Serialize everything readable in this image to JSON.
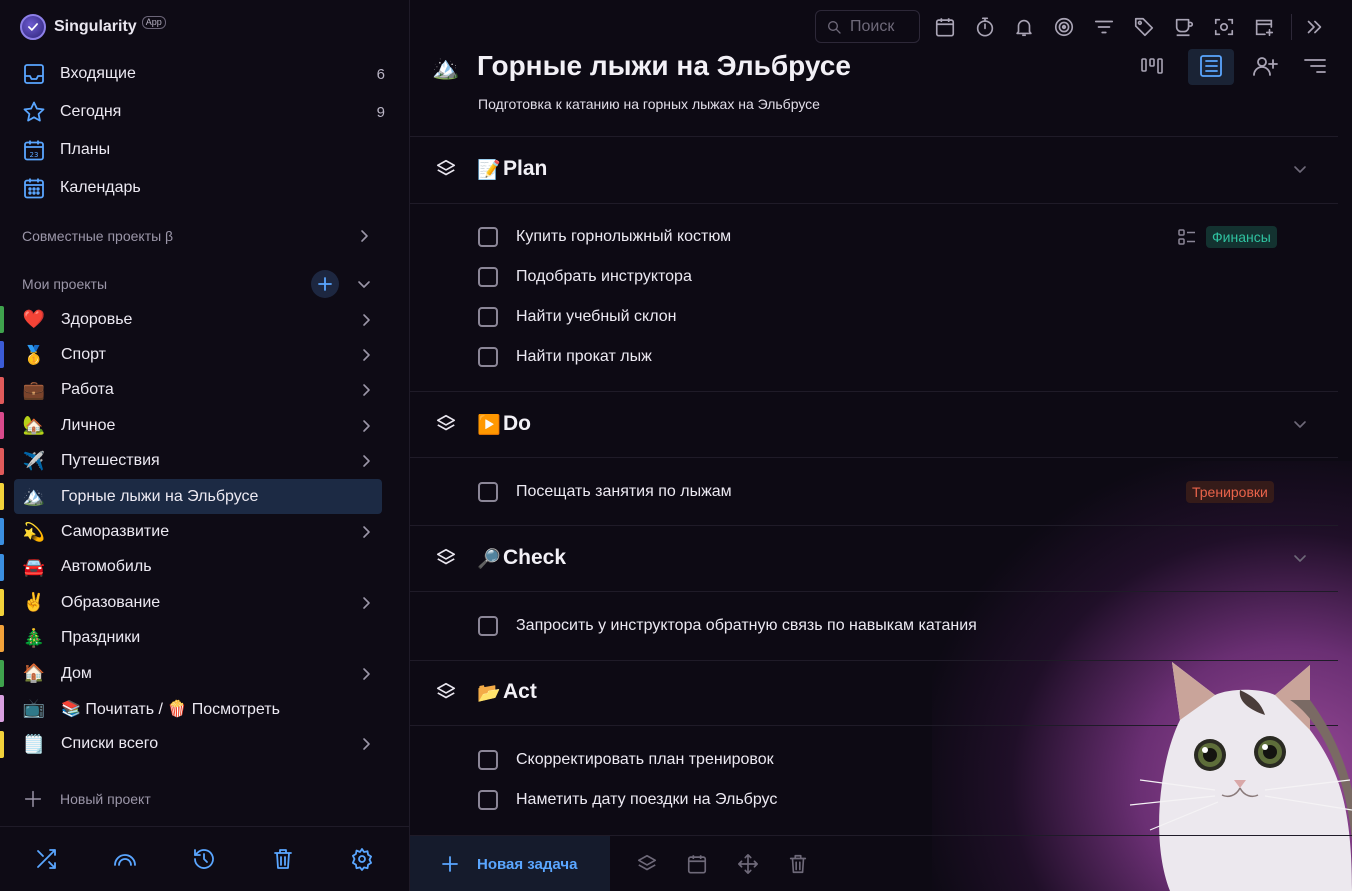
{
  "app": {
    "name": "Singularity",
    "badge": "App"
  },
  "nav": [
    {
      "label": "Входящие",
      "count": "6",
      "icon": "inbox-icon"
    },
    {
      "label": "Сегодня",
      "count": "9",
      "icon": "star-icon"
    },
    {
      "label": "Планы",
      "count": "",
      "icon": "plans-calendar-icon"
    },
    {
      "label": "Календарь",
      "count": "",
      "icon": "calendar-grid-icon"
    }
  ],
  "sections": {
    "shared": "Совместные проекты β",
    "mine": "Мои проекты"
  },
  "projects": [
    {
      "emoji": "❤️",
      "label": "Здоровье",
      "color": "#3fa34d"
    },
    {
      "emoji": "🥇",
      "label": "Спорт",
      "color": "#3b5bd6"
    },
    {
      "emoji": "💼",
      "label": "Работа",
      "color": "#e05a5a"
    },
    {
      "emoji": "🏡",
      "label": "Личное",
      "color": "#d94a8c"
    },
    {
      "emoji": "✈️",
      "label": "Путешествия",
      "color": "#e05a5a"
    },
    {
      "emoji": "🏔️",
      "label": "Горные лыжи на Эльбрусе",
      "color": "#f2d23a"
    },
    {
      "emoji": "💫",
      "label": "Саморазвитие",
      "color": "#3b8fe0"
    },
    {
      "emoji": "🚘",
      "label": "Автомобиль",
      "color": "#3b8fe0"
    },
    {
      "emoji": "✌️",
      "label": "Образование",
      "color": "#f2d23a"
    },
    {
      "emoji": "🎄",
      "label": "Праздники",
      "color": "#f2a23a"
    },
    {
      "emoji": "🏠",
      "label": "Дом",
      "color": "#3fa34d"
    },
    {
      "emoji": "📺",
      "label": "📚 Почитать / 🍿 Посмотреть",
      "color": "#d9a0e0"
    },
    {
      "emoji": "🗒️",
      "label": "Списки всего",
      "color": "#f2d23a"
    }
  ],
  "new_project": "Новый проект",
  "search": {
    "placeholder": "Поиск"
  },
  "project": {
    "emoji": "🏔️",
    "title": "Горные лыжи на Эльбрусе",
    "description": "Подготовка к катанию на горных лыжах на Эльбрусе"
  },
  "groups": [
    {
      "emoji": "📝",
      "title": "Plan",
      "tasks": [
        {
          "text": "Купить горнолыжный костюм",
          "tag": "Финансы"
        },
        {
          "text": "Подобрать инструктора"
        },
        {
          "text": "Найти учебный склон"
        },
        {
          "text": "Найти прокат лыж"
        }
      ]
    },
    {
      "emoji": "▶️",
      "title": "Do",
      "tasks": [
        {
          "text": "Посещать занятия по лыжам",
          "tag": "Тренировки"
        }
      ]
    },
    {
      "emoji": "🔎",
      "title": "Check",
      "tasks": [
        {
          "text": "Запросить у инструктора обратную связь по навыкам катания"
        }
      ]
    },
    {
      "emoji": "📂",
      "title": "Act",
      "tasks": [
        {
          "text": "Скорректировать план тренировок"
        },
        {
          "text": "Наметить дату поездки на Эльбрус"
        }
      ]
    }
  ],
  "footer": {
    "new_task": "Новая задача"
  },
  "colors": {
    "accent": "#5aa6ff",
    "tag_finance": "#2fc2a0",
    "tag_training": "#e9634a",
    "active_project_bg": "#1c2a44"
  }
}
